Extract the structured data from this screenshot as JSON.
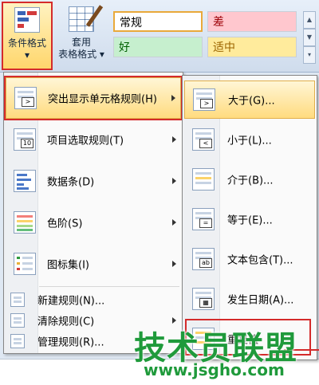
{
  "ribbon": {
    "conditional_format": {
      "line1": "条件格式",
      "line2": "▾"
    },
    "format_table": {
      "line1": "套用",
      "line2": "表格格式 ▾"
    },
    "styles": {
      "normal": "常规",
      "bad": "差",
      "good": "好",
      "neutral": "适中"
    },
    "scroll": {
      "up": "▲",
      "down": "▼",
      "more": "▾"
    }
  },
  "menu1": {
    "items": [
      {
        "label": "突出显示单元格规则(H)"
      },
      {
        "label": "项目选取规则(T)"
      },
      {
        "label": "数据条(D)"
      },
      {
        "label": "色阶(S)"
      },
      {
        "label": "图标集(I)"
      }
    ],
    "small_items": [
      {
        "label": "新建规则(N)..."
      },
      {
        "label": "清除规则(C)"
      },
      {
        "label": "管理规则(R)..."
      }
    ]
  },
  "menu2": {
    "items": [
      {
        "label": "大于(G)...",
        "icon_text": ">"
      },
      {
        "label": "小于(L)...",
        "icon_text": "<"
      },
      {
        "label": "介于(B)..."
      },
      {
        "label": "等于(E)...",
        "icon_text": "="
      },
      {
        "label": "文本包含(T)...",
        "icon_text": "ab"
      },
      {
        "label": "发生日期(A)..."
      },
      {
        "label": "重复值"
      }
    ]
  },
  "watermark": {
    "brand": "技术员联盟",
    "url": "www.jsgho.com"
  },
  "colors": {
    "accent": "#d42b2b",
    "watermark": "#1f9a3b",
    "highlight": "#ffdb7f"
  }
}
